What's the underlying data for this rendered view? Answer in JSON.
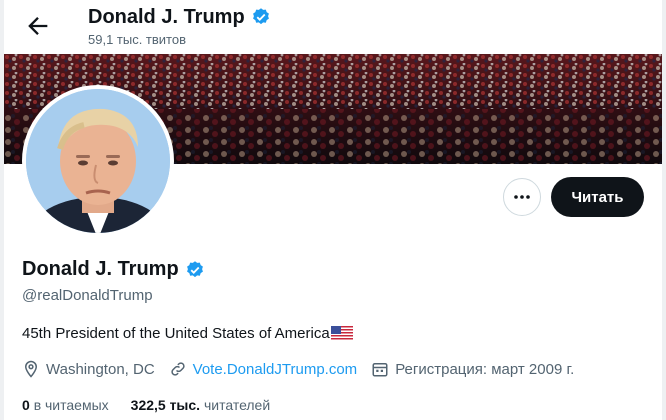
{
  "header": {
    "name": "Donald J. Trump",
    "tweet_count": "59,1 тыс. твитов"
  },
  "profile": {
    "name": "Donald J. Trump",
    "handle": "@realDonaldTrump",
    "bio": "45th President of the United States of America",
    "location": "Washington, DC",
    "website": "Vote.DonaldJTrump.com",
    "joined": "Регистрация: март 2009 г.",
    "following_count": "0",
    "following_label": "в читаемых",
    "followers_count": "322,5 тыс.",
    "followers_label": "читателей"
  },
  "actions": {
    "follow_label": "Читать"
  },
  "colors": {
    "accent": "#1d9bf0",
    "follow_bg": "#0f1419",
    "muted": "#536471"
  }
}
